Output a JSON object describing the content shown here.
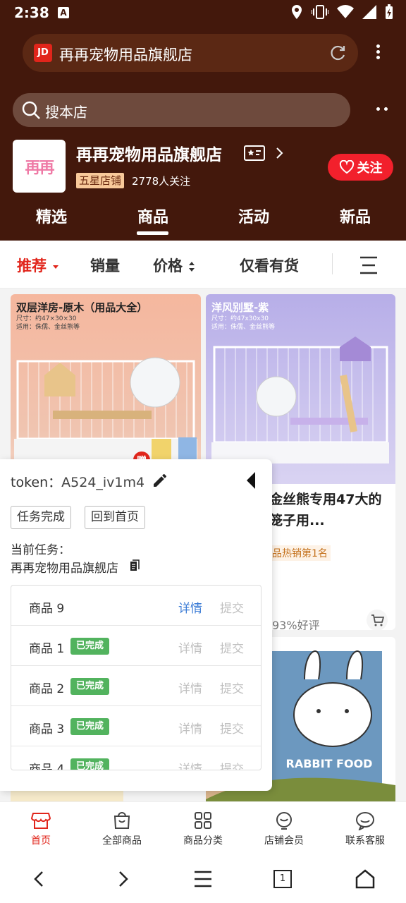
{
  "status_bar": {
    "time": "2:38"
  },
  "browser": {
    "url_title": "再再宠物用品旗舰店"
  },
  "store_search": {
    "placeholder": "搜本店"
  },
  "shop": {
    "name": "再再宠物用品旗舰店",
    "logo_text": "再再",
    "rating_badge": "五星店铺",
    "followers": "2778人关注",
    "follow_button": "关注"
  },
  "tabs": [
    "精选",
    "商品",
    "活动",
    "新品"
  ],
  "filters": {
    "recommend": "推荐",
    "sales": "销量",
    "price": "价格",
    "in_stock": "仅看有货"
  },
  "products": [
    {
      "img_title": "双层洋房-原木（用品大全）",
      "img_size": "尺寸：约47×30×30",
      "img_use": "适用：侏儒、金丝熊等",
      "gift_badge": "赠"
    },
    {
      "img_title": "洋风别墅-紫",
      "img_size": "尺寸：约47x30x30",
      "img_use": "适用：侏儒、金丝熊等",
      "title": "鼠笼金丝熊专用47大的基础笼子用...",
      "hot_tag": "品热销第1名",
      "rating": "93%好评"
    },
    {
      "img_text": "RABBIT FOOD"
    }
  ],
  "bottom_nav": [
    "首页",
    "全部商品",
    "商品分类",
    "店铺会员",
    "联系客服"
  ],
  "overlay": {
    "token_label": "token：",
    "token_value": "A524_iv1m4",
    "task_done_button": "任务完成",
    "home_button": "回到首页",
    "current_task_label": "当前任务：",
    "current_task_value": "再再宠物用品旗舰店",
    "tasks": [
      {
        "name": "商品 9",
        "status": "",
        "detail": "详情",
        "submit": "提交"
      },
      {
        "name": "商品 1",
        "status": "已完成",
        "detail": "详情",
        "submit": "提交"
      },
      {
        "name": "商品 2",
        "status": "已完成",
        "detail": "详情",
        "submit": "提交"
      },
      {
        "name": "商品 3",
        "status": "已完成",
        "detail": "详情",
        "submit": "提交"
      },
      {
        "name": "商品 4",
        "status": "已完成",
        "detail": "详情",
        "submit": "提交"
      }
    ]
  },
  "system_nav": {
    "tab_count": "1"
  }
}
